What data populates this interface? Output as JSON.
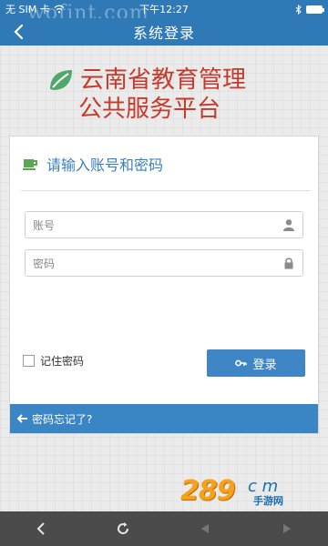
{
  "status_bar": {
    "carrier": "无 SIM 卡",
    "time": "下午12:27",
    "battery_level": 1.0
  },
  "watermark": "wofint.com",
  "nav": {
    "title": "系统登录"
  },
  "brand": {
    "line1": "云南省教育管理",
    "line2": "公共服务平台",
    "color": "#c53a2b",
    "leaf_color": "#4fa86d"
  },
  "login_card": {
    "heading": "请输入账号和密码",
    "account_placeholder": "账号",
    "password_placeholder": "密码",
    "remember_label": "记住密码",
    "remember_checked": false,
    "login_button": "登录",
    "forgot_link": "密码忘记了?"
  },
  "site_logo": {
    "number": "289",
    "suffix": "c m",
    "subtitle": "手游网"
  },
  "colors": {
    "accent": "#2f79b6",
    "button": "#3f86c7",
    "link_bar": "#3a86c4",
    "bottom_bar": "#4b4b4b"
  },
  "icons": {
    "back": "chevron-left-icon",
    "user": "user-icon",
    "lock": "lock-icon",
    "key": "key-icon",
    "cup": "cup-icon",
    "arrow": "arrow-left-icon",
    "reload": "reload-icon",
    "prev": "triangle-left-icon",
    "next": "triangle-right-icon"
  }
}
